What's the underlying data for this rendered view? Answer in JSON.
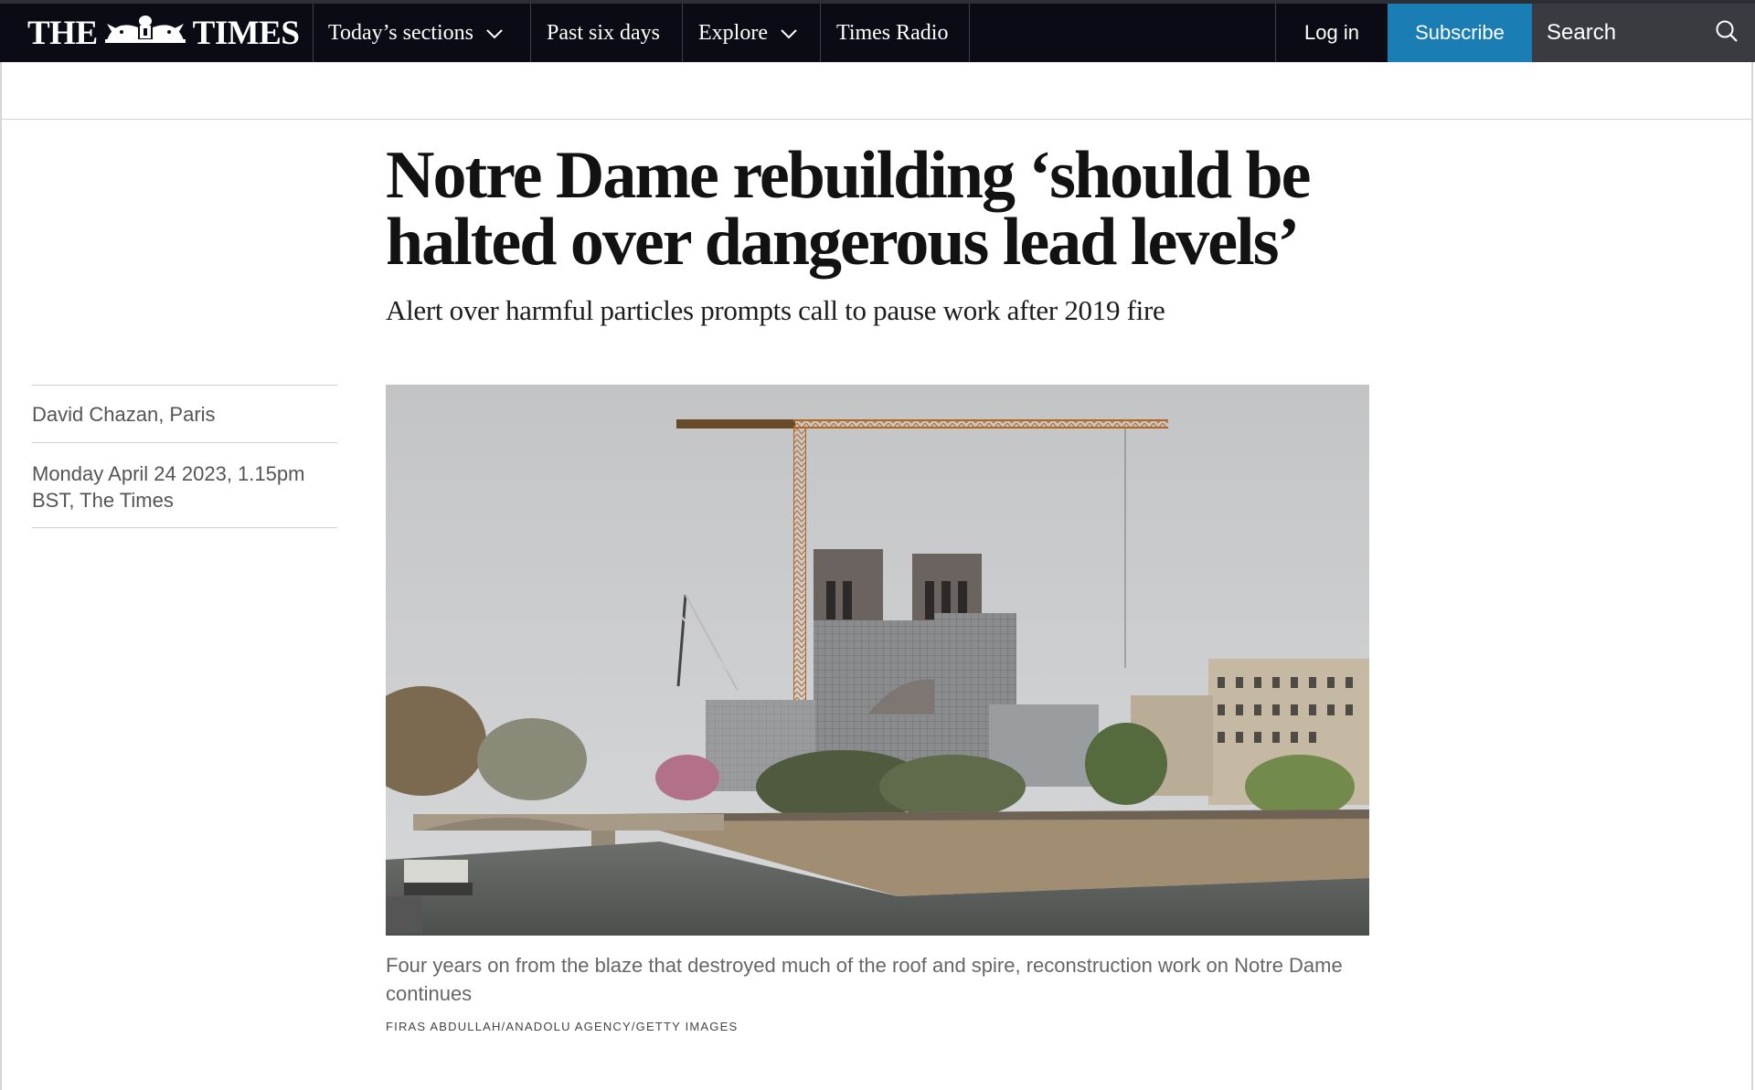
{
  "header": {
    "logo_left": "THE",
    "logo_right": "TIMES",
    "nav": [
      {
        "label": "Today’s sections",
        "has_dropdown": true
      },
      {
        "label": "Past six days",
        "has_dropdown": false
      },
      {
        "label": "Explore",
        "has_dropdown": true
      },
      {
        "label": "Times Radio",
        "has_dropdown": false
      }
    ],
    "login_label": "Log in",
    "subscribe_label": "Subscribe",
    "search_label": "Search"
  },
  "article": {
    "headline": "Notre Dame rebuilding ‘should be halted over dangerous lead levels’",
    "standfirst": "Alert over harmful particles prompts call to pause work after 2019 fire",
    "author": "David Chazan, Paris",
    "dateline": "Monday April 24 2023, 1.15pm BST, The Times",
    "image": {
      "caption": "Four years on from the blaze that destroyed much of the roof and spire, reconstruction work on Notre Dame continues",
      "credit": "FIRAS ABDULLAH/ANADOLU AGENCY/GETTY IMAGES"
    }
  },
  "colors": {
    "topbar": "#0b0b16",
    "subscribe": "#1a7db3",
    "search_bg": "#3a3b40",
    "headline": "#121212",
    "byline": "#555555"
  },
  "icons": {
    "nav_dropdown": "chevron-down-icon",
    "search": "search-icon",
    "logo": "royal-crest-icon"
  }
}
